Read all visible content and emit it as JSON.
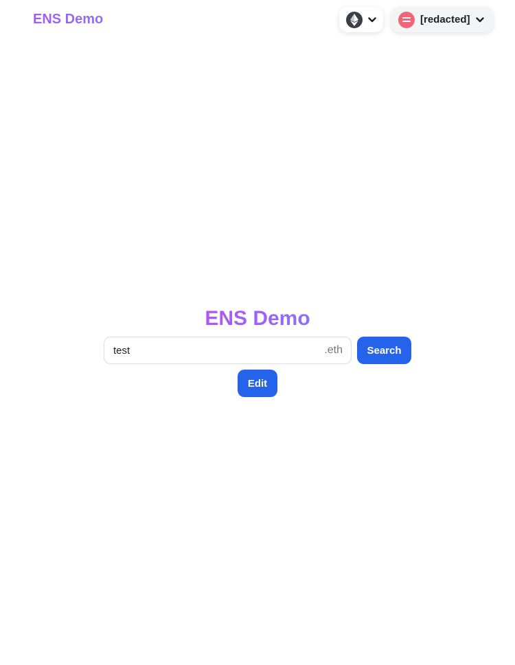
{
  "header": {
    "brand": "ENS Demo",
    "network_icon": "ethereum-icon",
    "account_label": "[redacted]",
    "colors": {
      "brand_gradient_start": "#a35cf6",
      "brand_gradient_end": "#8d6ff7",
      "avatar": "#f1657a"
    }
  },
  "main": {
    "title": "ENS Demo",
    "search": {
      "value": "test",
      "suffix": ".eth"
    },
    "search_button": "Search",
    "edit_button": "Edit",
    "colors": {
      "button": "#2563eb"
    }
  }
}
